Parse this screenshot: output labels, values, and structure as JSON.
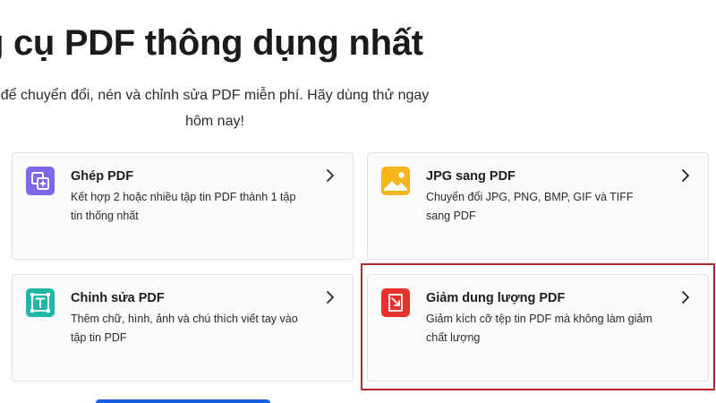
{
  "hero": {
    "title": "g cụ PDF thông dụng nhất",
    "subtitle_line1": "để chuyển đổi, nén và chỉnh sửa PDF miễn phí. Hãy dùng thử ngay",
    "subtitle_line2": "hôm nay!"
  },
  "tools": [
    {
      "title": "Ghép PDF",
      "description": "Kết hợp 2 hoặc nhiều tập tin PDF thành 1 tập tin thống nhất",
      "icon": "merge-pdf-icon",
      "color": "#7b68ee"
    },
    {
      "title": "JPG sang PDF",
      "description": "Chuyển đổi JPG, PNG, BMP, GIF và TIFF sang PDF",
      "icon": "image-icon",
      "color": "#f5b51e"
    },
    {
      "title": "Chỉnh sửa PDF",
      "description": "Thêm chữ, hình, ảnh và chú thích viết tay vào tập tin PDF",
      "icon": "edit-text-icon",
      "color": "#1fb7a6"
    },
    {
      "title": "Giảm dung lượng PDF",
      "description": "Giảm kích cỡ tệp tin PDF mà không làm giảm chất lượng",
      "icon": "compress-icon",
      "color": "#e5322d"
    }
  ],
  "colors": {
    "highlight_border": "#b2272b",
    "primary_button": "#1861e0"
  }
}
